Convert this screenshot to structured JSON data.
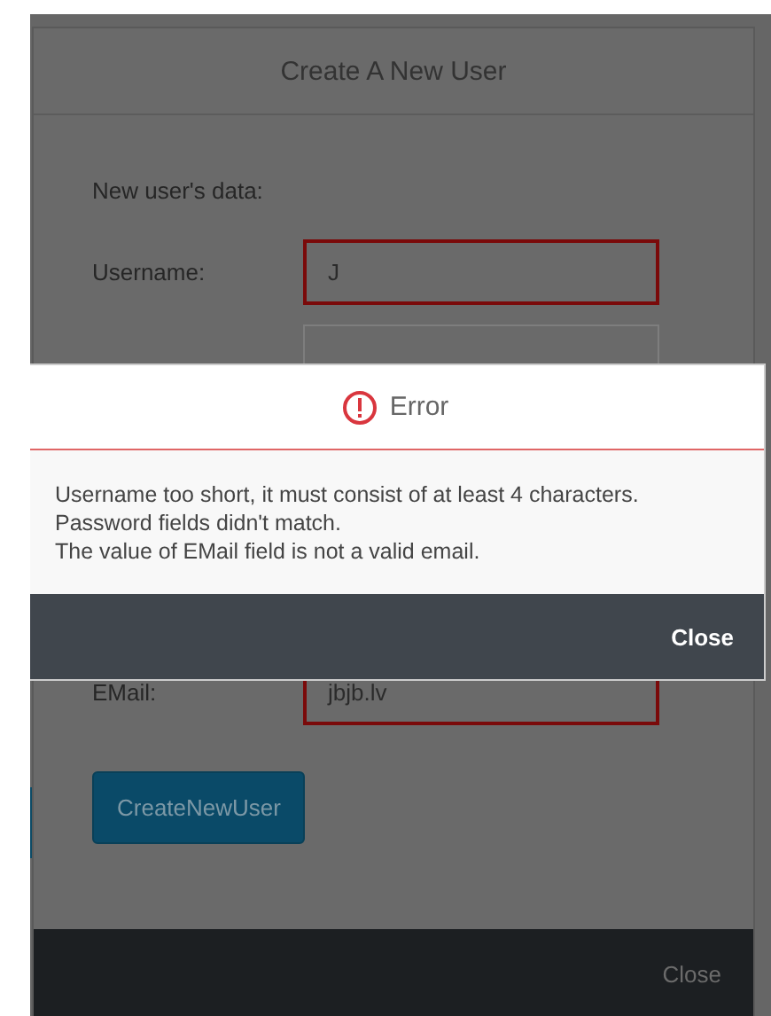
{
  "dialog": {
    "title": "Create A New User",
    "intro": "New user's data:",
    "fields": [
      {
        "label": "Username:",
        "value": "J",
        "invalid": true
      },
      {
        "invalid": false
      },
      {
        "label": "EMail:",
        "value": "jbjb.lv",
        "invalid": true
      }
    ],
    "submit": "CreateNewUser",
    "close": "Close"
  },
  "error": {
    "title": "Error",
    "messages": [
      "Username too short, it must consist of at least 4 characters.",
      "Password fields didn't match.",
      "The value of EMail field is not a valid email."
    ],
    "close": "Close"
  }
}
